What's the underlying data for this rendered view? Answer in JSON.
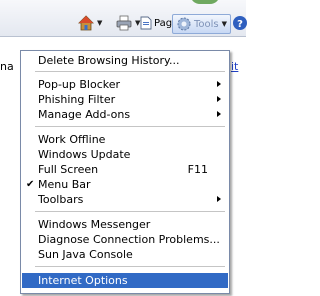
{
  "toolbar": {
    "page_label": "Page",
    "tools_label": "Tools"
  },
  "page": {
    "left_fragment": "na",
    "right_fragment": "it"
  },
  "menu": {
    "items": [
      {
        "label": "Delete Browsing History..."
      },
      {
        "label": "Pop-up Blocker",
        "submenu": true
      },
      {
        "label": "Phishing Filter",
        "submenu": true
      },
      {
        "label": "Manage Add-ons",
        "submenu": true
      },
      {
        "label": "Work Offline"
      },
      {
        "label": "Windows Update"
      },
      {
        "label": "Full Screen",
        "shortcut": "F11"
      },
      {
        "label": "Menu Bar",
        "checked": true
      },
      {
        "label": "Toolbars",
        "submenu": true
      },
      {
        "label": "Windows Messenger"
      },
      {
        "label": "Diagnose Connection Problems..."
      },
      {
        "label": "Sun Java Console"
      },
      {
        "label": "Internet Options",
        "highlighted": true
      }
    ]
  },
  "colors": {
    "highlight": "#316ac5",
    "menu_border": "#7a8aa8"
  }
}
